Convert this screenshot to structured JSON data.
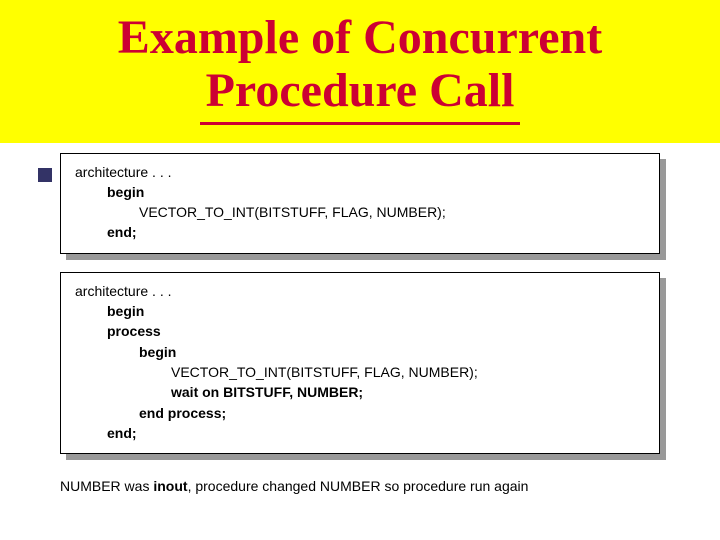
{
  "title": {
    "line1": "Example of Concurrent",
    "line2": "Procedure Call"
  },
  "box1": {
    "l0": "architecture . . .",
    "l1": "begin",
    "l2": "VECTOR_TO_INT(BITSTUFF, FLAG, NUMBER);",
    "l3": "end;"
  },
  "box2": {
    "l0": "architecture . . .",
    "l1": "begin",
    "l2": "process",
    "l3": "begin",
    "l4": "VECTOR_TO_INT(BITSTUFF, FLAG, NUMBER);",
    "l5": "wait on BITSTUFF, NUMBER;",
    "l6": "end process;",
    "l7": "end;"
  },
  "footer": {
    "pre": "NUMBER was ",
    "kw": "inout",
    "post": ", procedure changed NUMBER so procedure run again"
  }
}
